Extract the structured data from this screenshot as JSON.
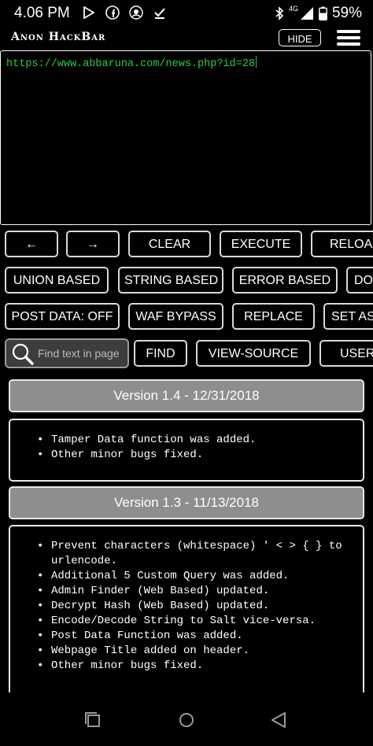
{
  "status_bar": {
    "time": "4.06 PM",
    "network_label": "4G",
    "battery_percent": "59%",
    "icons": [
      "play-store-icon",
      "facebook-icon",
      "app-emblem-icon",
      "download-done-icon",
      "bluetooth-icon",
      "signal-icon",
      "battery-icon"
    ]
  },
  "app": {
    "title": "Anon HackBar",
    "hide_label": "HIDE",
    "menu_icon": "hamburger-menu-icon"
  },
  "url_input": {
    "value": "https://www.abbaruna.com/news.php?id=28"
  },
  "toolbar": {
    "row1": [
      {
        "id": "back",
        "label": "←"
      },
      {
        "id": "forward",
        "label": "→"
      },
      {
        "id": "clear",
        "label": "CLEAR"
      },
      {
        "id": "execute",
        "label": "EXECUTE"
      },
      {
        "id": "reload",
        "label": "RELOAD"
      }
    ],
    "row2": [
      {
        "id": "union",
        "label": "UNION BASED"
      },
      {
        "id": "string",
        "label": "STRING BASED"
      },
      {
        "id": "error",
        "label": "ERROR BASED"
      },
      {
        "id": "double",
        "label": "DO"
      }
    ],
    "row3": [
      {
        "id": "post",
        "label": "POST DATA: OFF"
      },
      {
        "id": "waf",
        "label": "WAF BYPASS"
      },
      {
        "id": "replace",
        "label": "REPLACE"
      },
      {
        "id": "setas",
        "label": "SET AS"
      }
    ],
    "row4": [
      {
        "id": "find",
        "label": "FIND"
      },
      {
        "id": "viewsource",
        "label": "VIEW-SOURCE"
      },
      {
        "id": "user",
        "label": "USER-"
      }
    ]
  },
  "search": {
    "placeholder": "Find text in page"
  },
  "changelog": [
    {
      "version": "Version 1.4 - 12/31/2018",
      "notes": [
        "Tamper Data function was added.",
        "Other minor bugs fixed."
      ]
    },
    {
      "version": "Version 1.3 - 11/13/2018",
      "notes": [
        "Prevent characters (whitespace) ' < > { } to urlencode.",
        "Additional 5 Custom Query was added.",
        "Admin Finder (Web Based) updated.",
        "Decrypt Hash (Web Based) updated.",
        "Encode/Decode String to Salt vice-versa.",
        "Post Data Function was added.",
        "Webpage Title added on header.",
        "Other minor bugs fixed."
      ]
    }
  ],
  "nav_bar": {
    "icons": [
      "recent-apps-icon",
      "home-icon",
      "back-icon"
    ]
  },
  "colors": {
    "url_text": "#2ecc40",
    "version_header_bg": "#8e8e8e",
    "button_border": "#d8d8d8"
  }
}
